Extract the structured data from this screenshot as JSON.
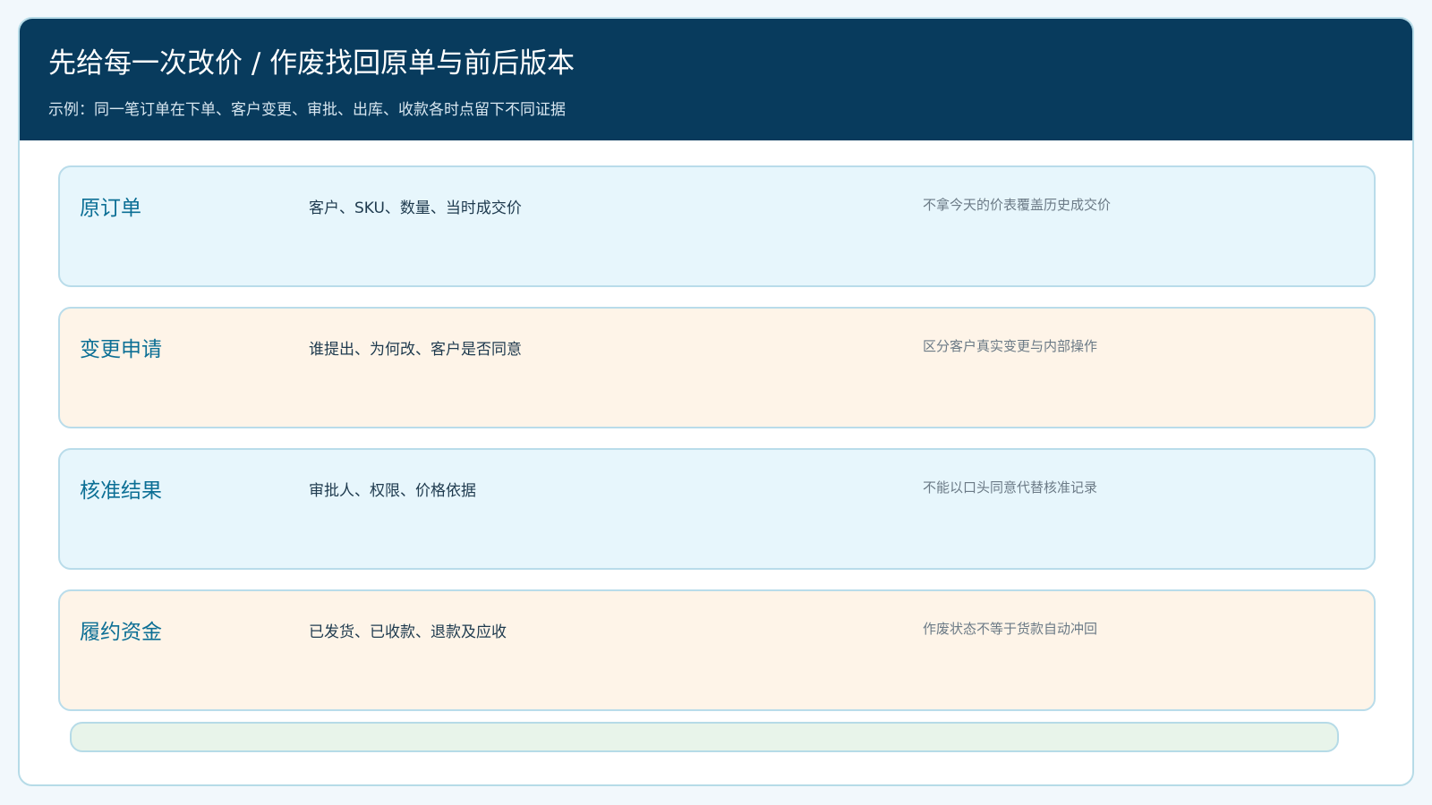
{
  "header": {
    "title": "先给每一次改价 / 作废找回原单与前后版本",
    "subtitle": "示例：同一笔订单在下单、客户变更、审批、出库、收款各时点留下不同证据"
  },
  "rows": [
    {
      "title": "原订单",
      "detail": "客户、SKU、数量、当时成交价",
      "note": "不拿今天的价表覆盖历史成交价"
    },
    {
      "title": "变更申请",
      "detail": "谁提出、为何改、客户是否同意",
      "note": "区分客户真实变更与内部操作"
    },
    {
      "title": "核准结果",
      "detail": "审批人、权限、价格依据",
      "note": "不能以口头同意代替核准记录"
    },
    {
      "title": "履约资金",
      "detail": "已发货、已收款、退款及应收",
      "note": "作废状态不等于货款自动冲回"
    }
  ],
  "colors": {
    "header_bg": "#083b5d",
    "row_blue": "#e7f6fc",
    "row_cream": "#fef4e8",
    "accent_title": "#0c6f95",
    "footer_bar": "#e8f4ea"
  }
}
